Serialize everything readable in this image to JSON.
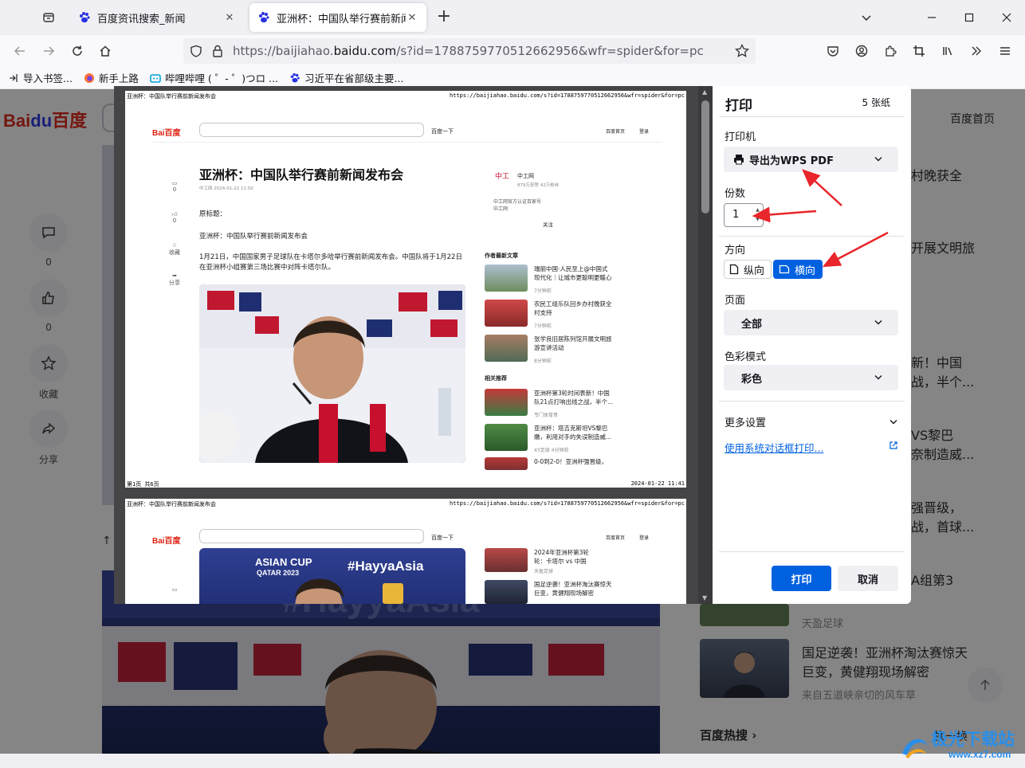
{
  "tabs": [
    {
      "title": "百度资讯搜索_新闻",
      "active": false
    },
    {
      "title": "亚洲杯：中国队举行赛前新闻发",
      "active": true
    }
  ],
  "url": {
    "prefix": "https://baijiahao.",
    "domain": "baidu.com",
    "rest": "/s?id=1788759770512662956&wfr=spider&for=pc"
  },
  "bookmarks": [
    "导入书签...",
    "新手上路",
    "哔哩哔哩 ( ゜- ゜)つロ ...",
    "习近平在省部级主要..."
  ],
  "page": {
    "logo": "Bai",
    "logo_du": "du",
    "logo_cn": "百度",
    "home_link": "百度首页",
    "side": [
      {
        "label": "0",
        "icon": "comment-icon"
      },
      {
        "label": "0",
        "icon": "thumbs-up-icon"
      },
      {
        "label": "收藏",
        "icon": "star-icon"
      },
      {
        "label": "分享",
        "icon": "share-icon"
      }
    ],
    "right_snippets": [
      "村晚获全",
      "开展文明旅",
      "新！中国",
      "战，半个...",
      "ⅤS黎巴",
      "奈制造威...",
      "强晋级，",
      "战，首球...",
      "A组第3"
    ],
    "news_card": {
      "line1": "国足逆袭！亚洲杯淘汰赛惊天",
      "line2": "巨变，黄健翔现场解密",
      "source": "来自五道峡亲切的风车草"
    },
    "source_tianying": "天盈足球",
    "hot_search": "百度热搜",
    "hot_more": "换一换",
    "left_hint": "↑卩"
  },
  "print": {
    "title": "打印",
    "sheet_count": "5 张纸",
    "printer_label": "打印机",
    "printer_value": "导出为WPS PDF",
    "copies_label": "份数",
    "copies_value": "1",
    "orientation_label": "方向",
    "portrait": "纵向",
    "landscape": "横向",
    "pages_label": "页面",
    "pages_value": "全部",
    "color_label": "色彩模式",
    "color_value": "彩色",
    "more_settings": "更多设置",
    "system_dialog": "使用系统对话框打印...",
    "print_button": "打印",
    "cancel_button": "取消"
  },
  "preview": {
    "header_left": "亚洲杯：中国队举行赛前新闻发布会",
    "header_right": "https://baijiahao.baidu.com/s?id=1788759770512662956&wfr=spider&for=pc",
    "search_btn": "百度一下",
    "nav_home": "百度首页",
    "nav_login": "登录",
    "logo": "Bai百度",
    "article_title": "亚洲杯：中国队举行赛前新闻发布会",
    "byline": "中工网   2024-01-22 11:50",
    "orig_title": "原标题：",
    "sub_title": "亚洲杯：中国队举行赛前新闻发布会",
    "para1": "1月21日，中国国家男子足球队在卡塔尔多哈举行赛前新闻发布会。中国队将于1月22日",
    "para2": "在亚洲杯小组赛第三场比赛中对阵卡塔尔队。",
    "author_name": "中工网",
    "author_fans": "879万获赞 42万粉丝",
    "author_desc1": "中工网官方认证百家号",
    "author_desc2": "中工网",
    "follow": "关注",
    "latest_header": "作者最新文章",
    "latest": [
      {
        "t1": "瑞丽中国·人民至上@中国式",
        "t2": "现代化｜让城市更聪明更暖心",
        "m": "7分钟前"
      },
      {
        "t1": "农民工组乐队回乡办村晚获全",
        "t2": "村支持",
        "m": "7分钟前"
      },
      {
        "t1": "张学良旧居陈列馆开展文明旅",
        "t2": "游宣讲活动",
        "m": "8分钟前"
      }
    ],
    "related_header": "相关推荐",
    "related": [
      {
        "t1": "亚洲杯第3轮时间表新！中国",
        "t2": "队21点打响出线之战，半个...",
        "m": "专门体育哥"
      },
      {
        "t1": "亚洲杯：塔吉克斯坦VS黎巴",
        "t2": "嫩，利用对手的失误制造威...",
        "m": "XY足球   4分钟前"
      },
      {
        "t1": "0-0到2-0！亚洲杯强晋级，",
        "t2": "",
        "m": ""
      }
    ],
    "p2_related": [
      {
        "t1": "2024年亚洲杯第3轮",
        "t2": "轮：卡塔尔 vs 中国",
        "m": "天盈足球"
      },
      {
        "t1": "国足逆袭！亚洲杯淘汰赛惊天",
        "t2": "巨变，黄健翔现场解密",
        "m": ""
      }
    ],
    "side_counts": [
      "0",
      "0",
      "收藏",
      "分享"
    ],
    "footer_left": "第1页 共6页",
    "footer_right": "2024-01-22 11:41",
    "photo_text1": "ASIAN CUP",
    "photo_text2": "QATAR 2023",
    "photo_text3": "#HayyaAsia"
  },
  "bigimg_text": "#HayyaAsia",
  "watermark": {
    "name": "极光下载站",
    "url": "www.xz7.com"
  },
  "colors": {
    "accent": "#0061e0",
    "baidu_red": "#de2010",
    "baidu_blue": "#2932e1",
    "arrow": "#e8262b"
  }
}
